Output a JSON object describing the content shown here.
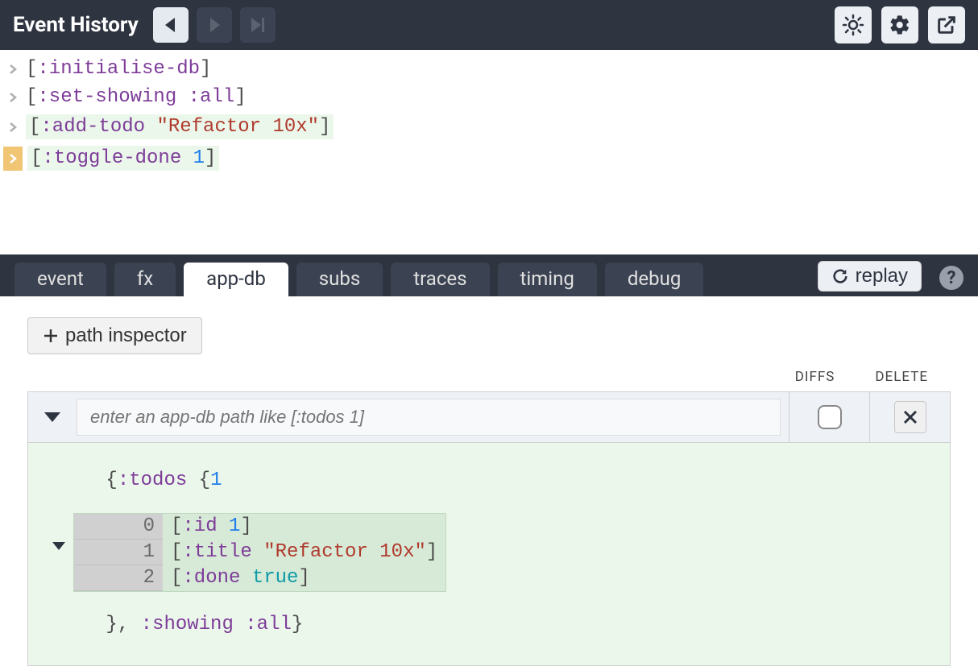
{
  "header": {
    "title": "Event History"
  },
  "events": [
    {
      "kw": ":initialise-db",
      "arg": null,
      "argType": null,
      "hl": false,
      "selected": false
    },
    {
      "kw": ":set-showing",
      "arg": ":all",
      "argType": "kw",
      "hl": false,
      "selected": false
    },
    {
      "kw": ":add-todo",
      "arg": "\"Refactor 10x\"",
      "argType": "str",
      "hl": true,
      "selected": false
    },
    {
      "kw": ":toggle-done",
      "arg": "1",
      "argType": "num",
      "hl": true,
      "selected": true
    }
  ],
  "tabs": {
    "items": [
      "event",
      "fx",
      "app-db",
      "subs",
      "traces",
      "timing",
      "debug"
    ],
    "active": "app-db"
  },
  "buttons": {
    "replay": "replay",
    "path_inspector": "path inspector"
  },
  "columns": {
    "diffs": "DIFFS",
    "delete": "DELETE"
  },
  "inspector": {
    "placeholder": "enter an app-db path like [:todos 1]"
  },
  "app_db": {
    "open": "{:todos {1",
    "entries": [
      {
        "idx": "0",
        "key": ":id",
        "val": "1",
        "valType": "num"
      },
      {
        "idx": "1",
        "key": ":title",
        "val": "\"Refactor 10x\"",
        "valType": "str"
      },
      {
        "idx": "2",
        "key": ":done",
        "val": "true",
        "valType": "bool"
      }
    ],
    "close": "}, :showing :all}"
  }
}
